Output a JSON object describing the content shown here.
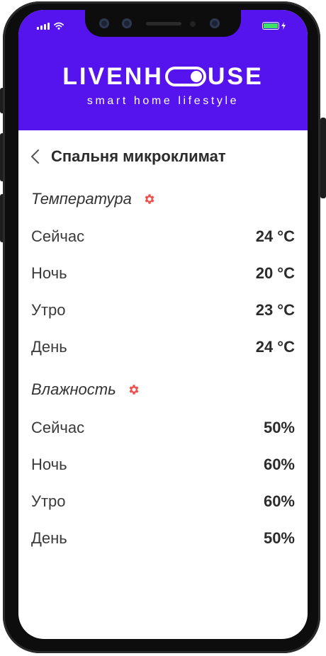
{
  "brand": {
    "title_left": "LIVENH",
    "title_right": "USE",
    "tagline": "smart home lifestyle"
  },
  "page": {
    "title": "Спальня микроклимат"
  },
  "temperature": {
    "label": "Температура",
    "rows": [
      {
        "label": "Сейчас",
        "value": "24 °C"
      },
      {
        "label": "Ночь",
        "value": "20 °C"
      },
      {
        "label": "Утро",
        "value": "23 °C"
      },
      {
        "label": "День",
        "value": "24 °C"
      }
    ]
  },
  "humidity": {
    "label": "Влажность",
    "rows": [
      {
        "label": "Сейчас",
        "value": "50%"
      },
      {
        "label": "Ночь",
        "value": "60%"
      },
      {
        "label": "Утро",
        "value": "60%"
      },
      {
        "label": "День",
        "value": "50%"
      }
    ]
  },
  "colors": {
    "header": "#5514ee",
    "gear_accent": "#f0504b",
    "battery": "#3ee06a"
  },
  "icons": [
    "signal-icon",
    "wifi-icon",
    "battery-icon",
    "charging-icon",
    "back-chevron-icon",
    "gear-icon"
  ]
}
